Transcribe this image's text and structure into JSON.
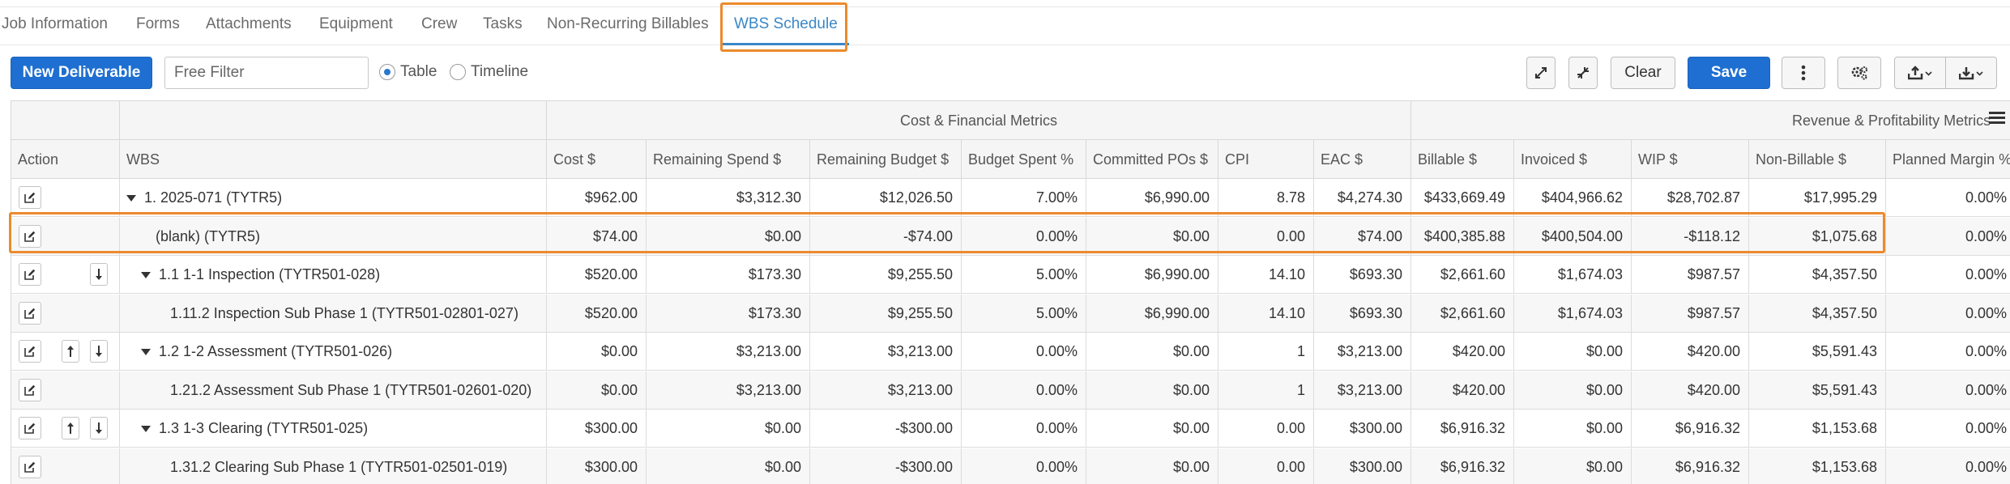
{
  "tabs": [
    {
      "label": "Job Information"
    },
    {
      "label": "Forms"
    },
    {
      "label": "Attachments"
    },
    {
      "label": "Equipment"
    },
    {
      "label": "Crew"
    },
    {
      "label": "Tasks"
    },
    {
      "label": "Non-Recurring Billables"
    },
    {
      "label": "WBS Schedule",
      "active": true
    }
  ],
  "toolbar": {
    "new_deliverable_label": "New Deliverable",
    "filter_placeholder": "Free Filter",
    "filter_value": "",
    "view_options": [
      {
        "label": "Table",
        "selected": true
      },
      {
        "label": "Timeline",
        "selected": false
      }
    ],
    "expand_icon": "expand-diagonal-icon",
    "collapse_icon": "collapse-diagonal-icon",
    "clear_label": "Clear",
    "save_label": "Save",
    "more_icon": "vertical-ellipsis-icon",
    "settings_icon": "gears-icon",
    "upload_icon": "upload-icon",
    "download_icon": "download-icon"
  },
  "grid": {
    "groups": [
      {
        "label": ""
      },
      {
        "label": ""
      },
      {
        "label": "Cost & Financial Metrics"
      },
      {
        "label": "Revenue & Profitability Metrics"
      }
    ],
    "columns": [
      "Action",
      "WBS",
      "Cost $",
      "Remaining Spend $",
      "Remaining Budget $",
      "Budget Spent %",
      "Committed POs $",
      "CPI",
      "EAC $",
      "Billable $",
      "Invoiced $",
      "WIP $",
      "Non-Billable $",
      "Planned Margin %"
    ],
    "rows": [
      {
        "wbs": "1. 2025-071 (TYTR5)",
        "level": 0,
        "caret": true,
        "up": false,
        "down": false,
        "cells": [
          "$962.00",
          "$3,312.30",
          "$12,026.50",
          "7.00%",
          "$6,990.00",
          "8.78",
          "$4,274.30",
          "$433,669.49",
          "$404,966.62",
          "$28,702.87",
          "$17,995.29",
          "0.00%"
        ]
      },
      {
        "wbs": "(blank) (TYTR5)",
        "level": 1,
        "caret": false,
        "up": false,
        "down": false,
        "highlight": true,
        "cells": [
          "$74.00",
          "$0.00",
          "-$74.00",
          "0.00%",
          "$0.00",
          "0.00",
          "$74.00",
          "$400,385.88",
          "$400,504.00",
          "-$118.12",
          "$1,075.68",
          "0.00%"
        ]
      },
      {
        "wbs": "1.1 1-1 Inspection (TYTR501-028)",
        "level": 1,
        "caret": true,
        "up": false,
        "down": true,
        "cells": [
          "$520.00",
          "$173.30",
          "$9,255.50",
          "5.00%",
          "$6,990.00",
          "14.10",
          "$693.30",
          "$2,661.60",
          "$1,674.03",
          "$987.57",
          "$4,357.50",
          "0.00%"
        ]
      },
      {
        "wbs": "1.11.2 Inspection Sub Phase 1 (TYTR501-02801-027)",
        "level": 2,
        "caret": false,
        "up": false,
        "down": false,
        "cells": [
          "$520.00",
          "$173.30",
          "$9,255.50",
          "5.00%",
          "$6,990.00",
          "14.10",
          "$693.30",
          "$2,661.60",
          "$1,674.03",
          "$987.57",
          "$4,357.50",
          "0.00%"
        ]
      },
      {
        "wbs": "1.2 1-2 Assessment (TYTR501-026)",
        "level": 1,
        "caret": true,
        "up": true,
        "down": true,
        "cells": [
          "$0.00",
          "$3,213.00",
          "$3,213.00",
          "0.00%",
          "$0.00",
          "1",
          "$3,213.00",
          "$420.00",
          "$0.00",
          "$420.00",
          "$5,591.43",
          "0.00%"
        ]
      },
      {
        "wbs": "1.21.2 Assessment Sub Phase 1 (TYTR501-02601-020)",
        "level": 2,
        "caret": false,
        "up": false,
        "down": false,
        "cells": [
          "$0.00",
          "$3,213.00",
          "$3,213.00",
          "0.00%",
          "$0.00",
          "1",
          "$3,213.00",
          "$420.00",
          "$0.00",
          "$420.00",
          "$5,591.43",
          "0.00%"
        ]
      },
      {
        "wbs": "1.3 1-3 Clearing (TYTR501-025)",
        "level": 1,
        "caret": true,
        "up": true,
        "down": true,
        "cells": [
          "$300.00",
          "$0.00",
          "-$300.00",
          "0.00%",
          "$0.00",
          "0.00",
          "$300.00",
          "$6,916.32",
          "$0.00",
          "$6,916.32",
          "$1,153.68",
          "0.00%"
        ]
      },
      {
        "wbs": "1.31.2 Clearing Sub Phase 1 (TYTR501-02501-019)",
        "level": 2,
        "caret": false,
        "up": false,
        "down": false,
        "cells": [
          "$300.00",
          "$0.00",
          "-$300.00",
          "0.00%",
          "$0.00",
          "0.00",
          "$300.00",
          "$6,916.32",
          "$0.00",
          "$6,916.32",
          "$1,153.68",
          "0.00%"
        ]
      }
    ],
    "row_icons": {
      "edit": "edit-pencil-icon",
      "up": "arrow-up-icon",
      "down": "arrow-down-icon"
    }
  }
}
